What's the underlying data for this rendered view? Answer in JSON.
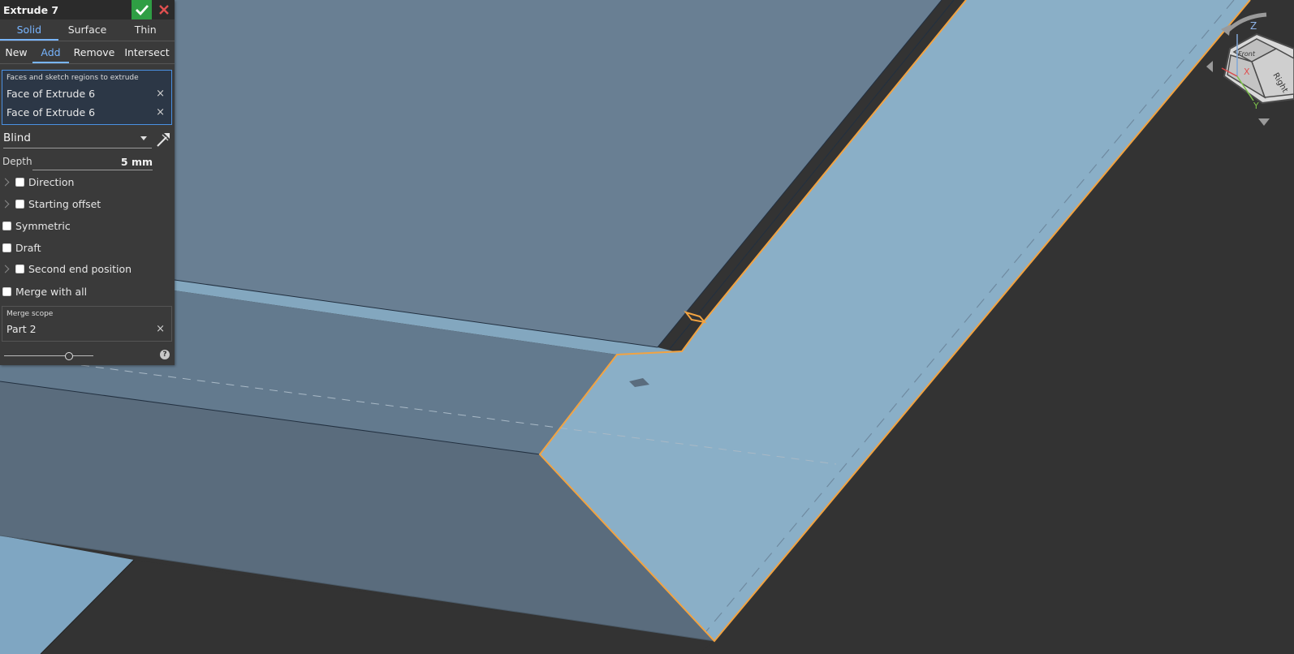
{
  "feature": {
    "title": "Extrude 7"
  },
  "tabs": [
    {
      "label": "Solid",
      "active": true
    },
    {
      "label": "Surface",
      "active": false
    },
    {
      "label": "Thin",
      "active": false
    }
  ],
  "operations": [
    {
      "label": "New",
      "active": false
    },
    {
      "label": "Add",
      "active": true
    },
    {
      "label": "Remove",
      "active": false
    },
    {
      "label": "Intersect",
      "active": false
    }
  ],
  "faces": {
    "label": "Faces and sketch regions to extrude",
    "items": [
      "Face of Extrude 6",
      "Face of Extrude 6"
    ],
    "remove_glyph": "×"
  },
  "end_type": {
    "value": "Blind"
  },
  "depth": {
    "label": "Depth",
    "value": "5 mm"
  },
  "options": {
    "direction": "Direction",
    "starting_offset": "Starting offset",
    "symmetric": "Symmetric",
    "draft": "Draft",
    "second_end": "Second end position",
    "merge_all": "Merge with all"
  },
  "merge_scope": {
    "label": "Merge scope",
    "value": "Part 2",
    "remove_glyph": "×"
  },
  "help": {
    "glyph": "?"
  },
  "viewcube": {
    "z_label": "Z",
    "x_label": "X",
    "y_label": "Y",
    "face_front": "Front",
    "face_right": "Right"
  },
  "colors": {
    "background": "#333333",
    "face_top": "#697f93",
    "face_selected": "#8aafc7",
    "face_side": "#5a6c7d",
    "selection_edge": "#f2a341",
    "accent": "#78b5ff",
    "ok": "#2f9e44",
    "cancel": "#e05050"
  }
}
